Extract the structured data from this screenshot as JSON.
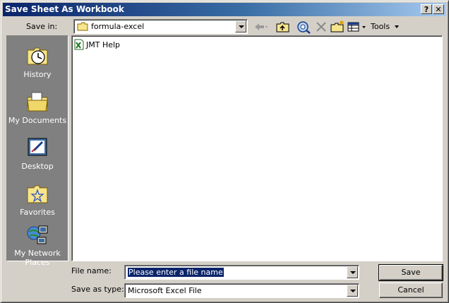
{
  "window": {
    "title": "Save Sheet As Workbook",
    "help_label": "?",
    "close_label": "✕"
  },
  "toolbar": {
    "save_in_label": "Save in:",
    "folder": "formula-excel",
    "tools_label": "Tools"
  },
  "places": [
    {
      "label": "History",
      "icon": "history-icon"
    },
    {
      "label": "My Documents",
      "icon": "my-documents-icon"
    },
    {
      "label": "Desktop",
      "icon": "desktop-icon"
    },
    {
      "label": "Favorites",
      "icon": "favorites-icon"
    },
    {
      "label": "My Network Places",
      "icon": "network-places-icon"
    }
  ],
  "files": [
    {
      "name": "JMT Help",
      "icon": "excel-file-icon"
    }
  ],
  "footer": {
    "file_name_label": "File name:",
    "file_name_value": "Please enter a file name",
    "save_type_label": "Save as type:",
    "save_type_value": "Microsoft Excel File",
    "save_label": "Save",
    "cancel_label": "Cancel"
  }
}
